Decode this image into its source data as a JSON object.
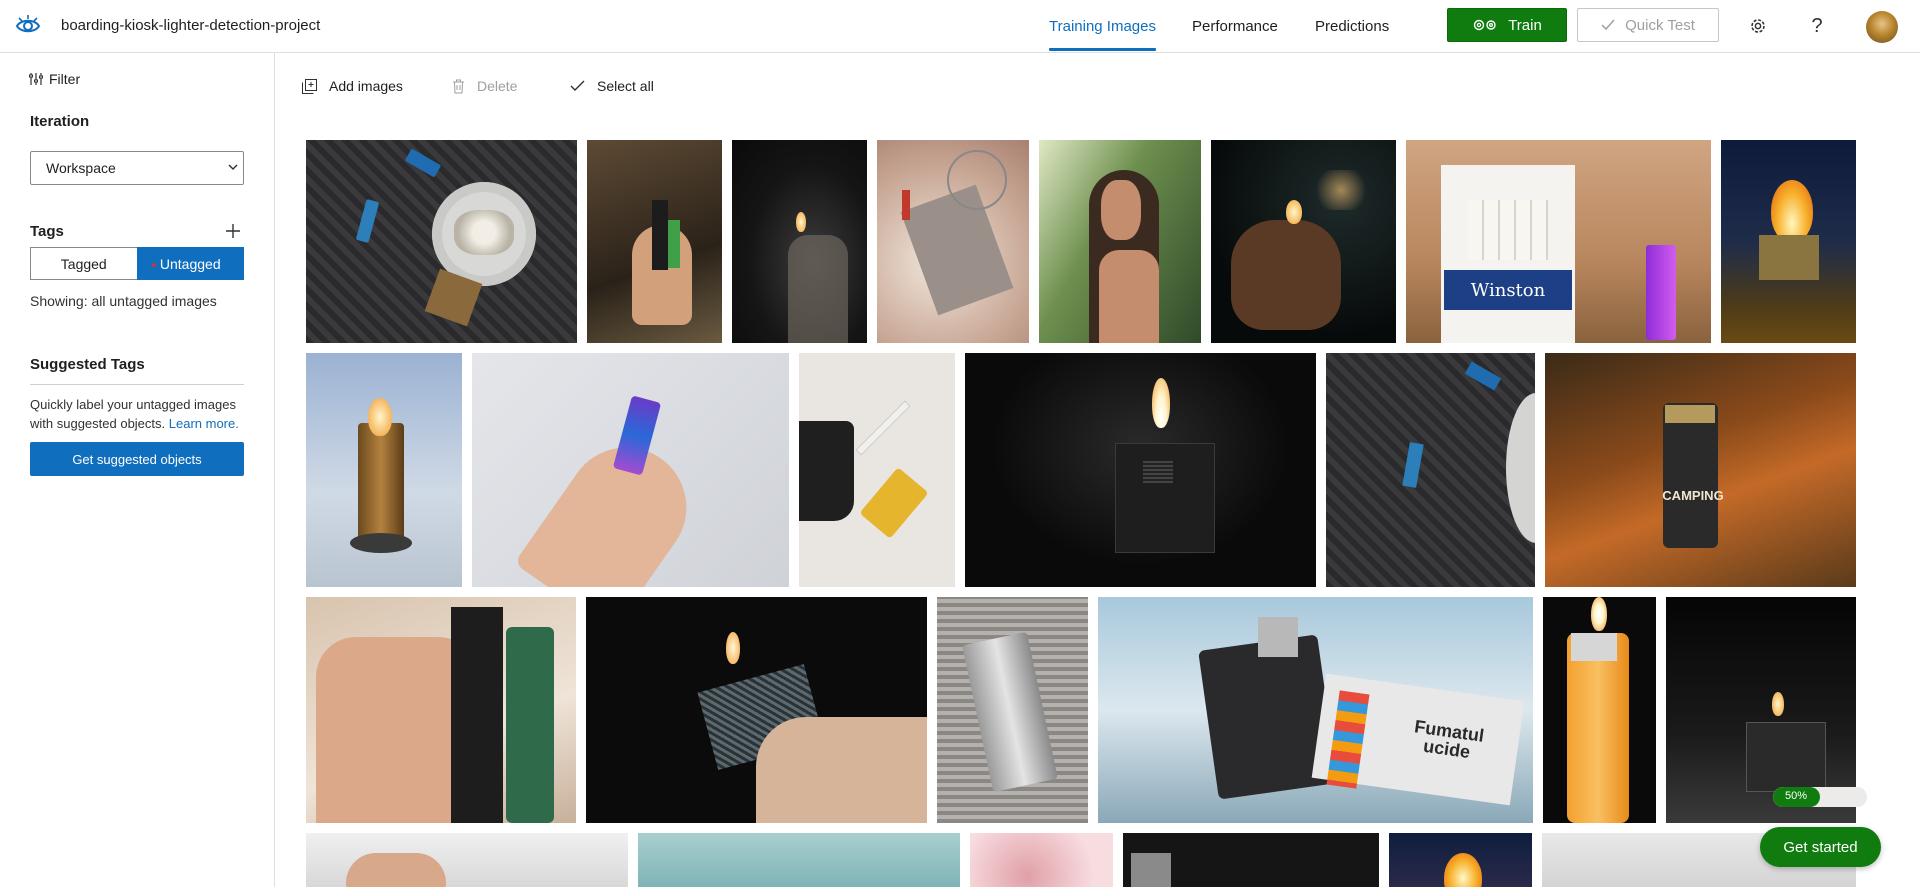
{
  "header": {
    "project_name": "boarding-kiosk-lighter-detection-project",
    "nav": [
      "Training Images",
      "Performance",
      "Predictions"
    ],
    "active_nav": "Training Images",
    "train_label": "Train",
    "quick_test_label": "Quick Test",
    "icons": [
      "eye-icon",
      "gear-icon",
      "help-icon"
    ],
    "accent_color": "#106ebe",
    "train_color": "#107c10"
  },
  "sidebar": {
    "filter_label": "Filter",
    "iteration_heading": "Iteration",
    "iteration_value": "Workspace",
    "tags_heading": "Tags",
    "tagged_label": "Tagged",
    "untagged_label": "Untagged",
    "showing_text": "Showing: all untagged images",
    "suggested_heading": "Suggested Tags",
    "suggested_desc": "Quickly label your untagged images with suggested objects.",
    "learn_more": "Learn more.",
    "suggest_button": "Get suggested objects"
  },
  "toolbar": {
    "add_images": "Add images",
    "delete": "Delete",
    "select_all": "Select all"
  },
  "cards": {
    "winston": "Winston",
    "camping": "CAMPING",
    "fumatul_1": "Fumatul",
    "fumatul_2": "ucide"
  },
  "get_started": {
    "progress_label": "50%",
    "progress_value": 0.5,
    "button_label": "Get started"
  }
}
